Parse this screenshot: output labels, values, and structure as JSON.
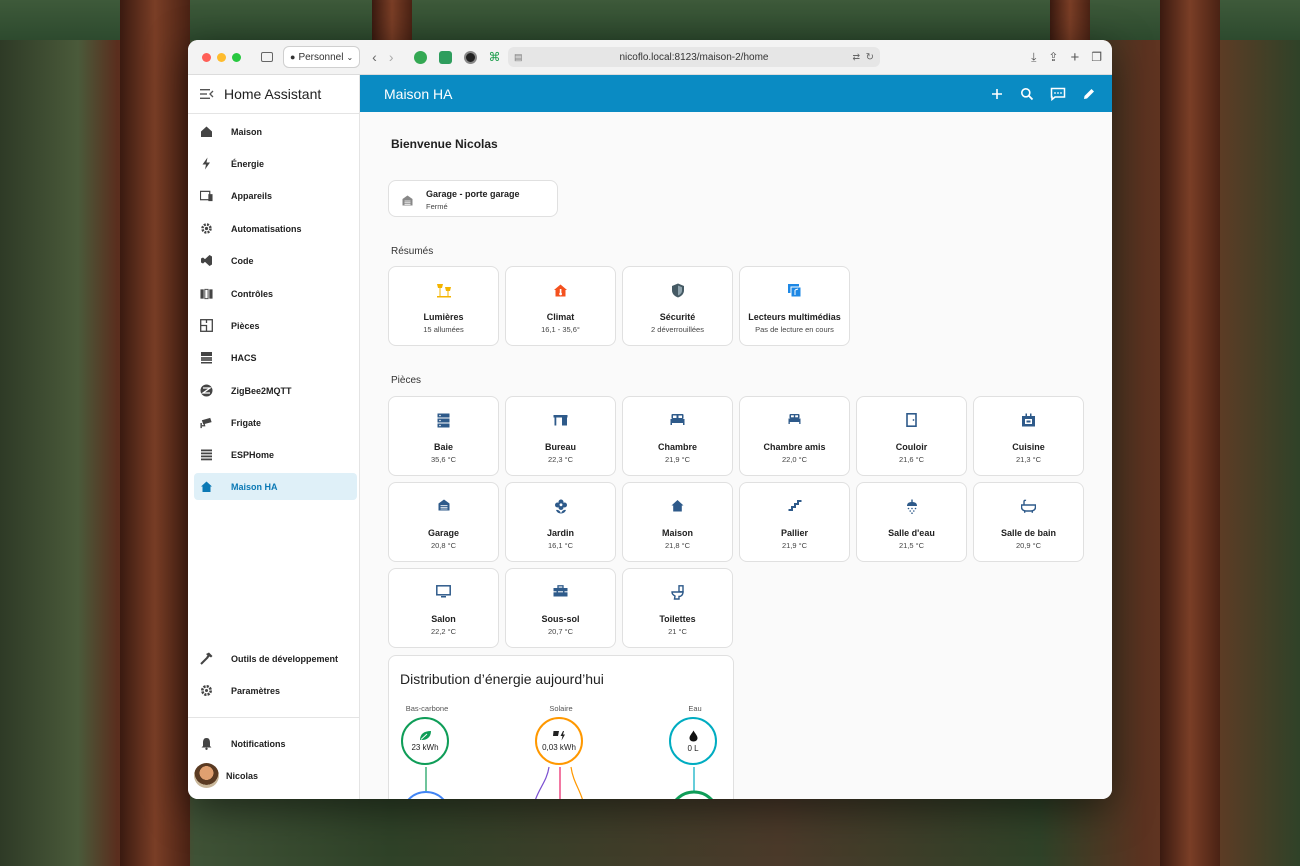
{
  "browser": {
    "profile": "Personnel",
    "url": "nicoflo.local:8123/maison-2/home"
  },
  "sidebar": {
    "title": "Home Assistant",
    "items": [
      {
        "label": "Maison",
        "icon": "home-icon"
      },
      {
        "label": "Énergie",
        "icon": "lightning-icon"
      },
      {
        "label": "Appareils",
        "icon": "devices-icon"
      },
      {
        "label": "Automatisations",
        "icon": "gear-icon"
      },
      {
        "label": "Code",
        "icon": "vscode-icon"
      },
      {
        "label": "Contrôles",
        "icon": "controls-icon"
      },
      {
        "label": "Pièces",
        "icon": "floorplan-icon"
      },
      {
        "label": "HACS",
        "icon": "hacs-icon"
      },
      {
        "label": "ZigBee2MQTT",
        "icon": "zigbee-icon"
      },
      {
        "label": "Frigate",
        "icon": "cctv-icon"
      },
      {
        "label": "ESPHome",
        "icon": "chip-icon"
      },
      {
        "label": "Maison HA",
        "icon": "home-icon",
        "active": true
      }
    ],
    "bottom_items": [
      {
        "label": "Outils de développement",
        "icon": "hammer-icon"
      },
      {
        "label": "Paramètres",
        "icon": "settings-icon"
      }
    ],
    "notifications": "Notifications",
    "user": "Nicolas"
  },
  "header": {
    "title": "Maison HA"
  },
  "main": {
    "welcome": "Bienvenue Nicolas",
    "garage": {
      "name": "Garage - porte garage",
      "state": "Fermé"
    },
    "summaries_label": "Résumés",
    "summaries": [
      {
        "name": "Lumières",
        "value": "15 allumées",
        "icon": "lamps-icon",
        "color": "#f4b400"
      },
      {
        "name": "Climat",
        "value": "16,1 - 35,6°",
        "icon": "home-thermometer-icon",
        "color": "#f4511e"
      },
      {
        "name": "Sécurité",
        "value": "2 déverrouillées",
        "icon": "shield-icon",
        "color": "#455a64"
      },
      {
        "name": "Lecteurs multimédias",
        "value": "Pas de lecture en cours",
        "icon": "media-icon",
        "color": "#1e88e5"
      }
    ],
    "rooms_label": "Pièces",
    "rooms": [
      {
        "name": "Baie",
        "value": "35,6 °C",
        "icon": "server-icon"
      },
      {
        "name": "Bureau",
        "value": "22,3 °C",
        "icon": "desk-icon"
      },
      {
        "name": "Chambre",
        "value": "21,9 °C",
        "icon": "bed-icon"
      },
      {
        "name": "Chambre amis",
        "value": "22,0 °C",
        "icon": "bed-icon"
      },
      {
        "name": "Couloir",
        "value": "21,6 °C",
        "icon": "door-icon"
      },
      {
        "name": "Cuisine",
        "value": "21,3 °C",
        "icon": "stove-icon"
      },
      {
        "name": "Garage",
        "value": "20,8 °C",
        "icon": "garage-icon"
      },
      {
        "name": "Jardin",
        "value": "16,1 °C",
        "icon": "flower-icon"
      },
      {
        "name": "Maison",
        "value": "21,8 °C",
        "icon": "home-icon"
      },
      {
        "name": "Pallier",
        "value": "21,9 °C",
        "icon": "stairs-icon"
      },
      {
        "name": "Salle d'eau",
        "value": "21,5 °C",
        "icon": "shower-icon"
      },
      {
        "name": "Salle de bain",
        "value": "20,9 °C",
        "icon": "bathtub-icon"
      },
      {
        "name": "Salon",
        "value": "22,2 °C",
        "icon": "monitor-icon"
      },
      {
        "name": "Sous-sol",
        "value": "20,7 °C",
        "icon": "toolbox-icon"
      },
      {
        "name": "Toilettes",
        "value": "21 °C",
        "icon": "toilet-icon"
      }
    ],
    "energy": {
      "title": "Distribution d’énergie aujourd’hui",
      "nodes": [
        {
          "label": "Bas-carbone",
          "value": "23 kWh",
          "icon": "leaf-icon",
          "color": "#0f9d58"
        },
        {
          "label": "Solaire",
          "value": "0,03 kWh",
          "icon": "solar-icon",
          "color": "#ff9800"
        },
        {
          "label": "Eau",
          "value": "0 L",
          "icon": "water-icon",
          "color": "#00acc1"
        }
      ]
    }
  }
}
